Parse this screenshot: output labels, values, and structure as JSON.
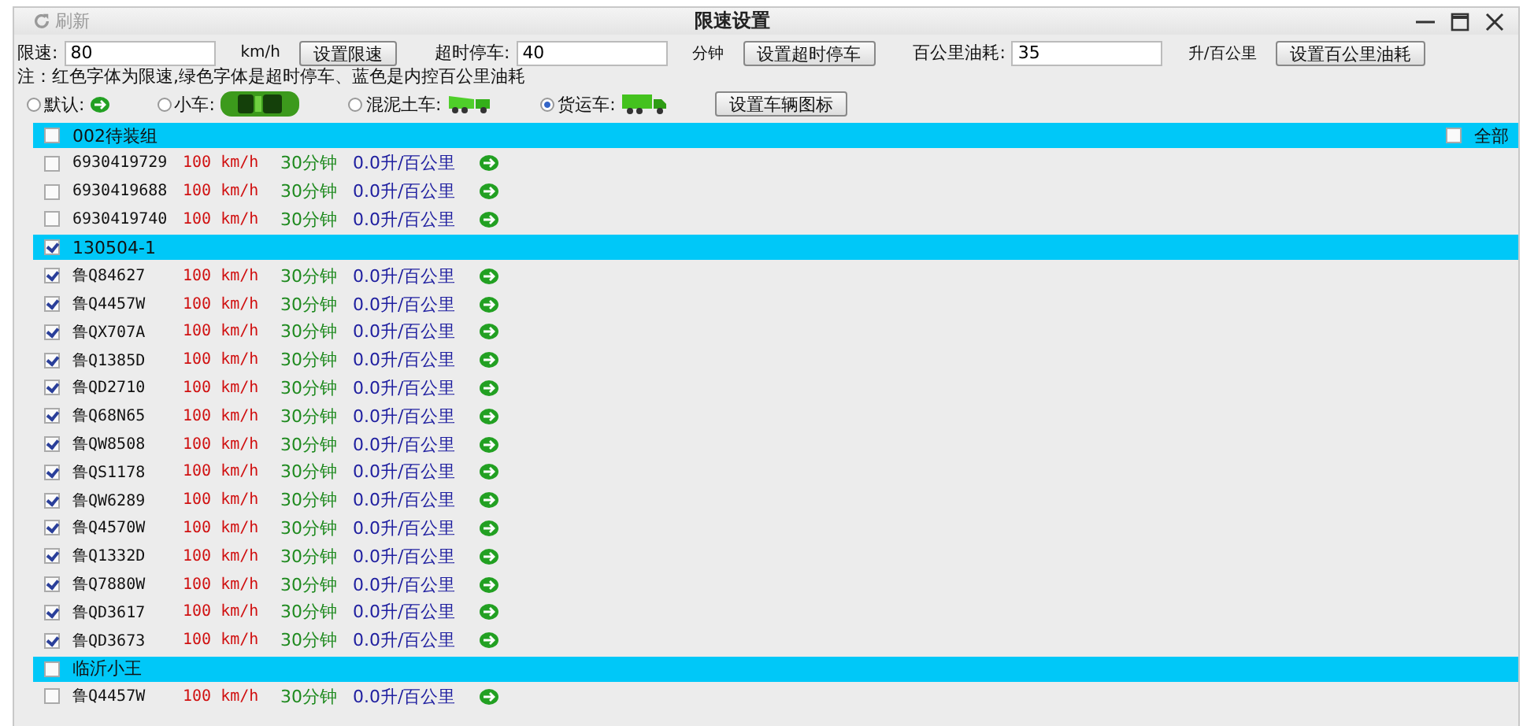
{
  "window": {
    "refresh": "刷新",
    "title": "限速设置"
  },
  "settings": [
    {
      "label": "限速:",
      "value": "80",
      "unit": "km/h",
      "button": "设置限速"
    },
    {
      "label": "超时停车:",
      "value": "40",
      "unit": "分钟",
      "button": "设置超时停车"
    },
    {
      "label": "百公里油耗:",
      "value": "35",
      "unit": "升/百公里",
      "button": "设置百公里油耗"
    }
  ],
  "note": "注：红色字体为限速,绿色字体是超时停车、蓝色是内控百公里油耗",
  "icon_options": [
    {
      "label": "默认:",
      "kind": "default",
      "selected": false
    },
    {
      "label": "小车:",
      "kind": "car",
      "selected": false
    },
    {
      "label": "混泥土车:",
      "kind": "mixer",
      "selected": false
    },
    {
      "label": "货运车:",
      "kind": "truck",
      "selected": true
    }
  ],
  "icon_button": "设置车辆图标",
  "select_all": {
    "label": "全部",
    "checked": false
  },
  "groups": [
    {
      "name": "002待装组",
      "checked": false,
      "vehicles": [
        {
          "plate": "6930419729",
          "speed": "100 km/h",
          "stop": "30分钟",
          "fuel": "0.0升/百公里",
          "checked": false
        },
        {
          "plate": "6930419688",
          "speed": "100 km/h",
          "stop": "30分钟",
          "fuel": "0.0升/百公里",
          "checked": false
        },
        {
          "plate": "6930419740",
          "speed": "100 km/h",
          "stop": "30分钟",
          "fuel": "0.0升/百公里",
          "checked": false
        }
      ]
    },
    {
      "name": "130504-1",
      "checked": true,
      "vehicles": [
        {
          "plate": "鲁Q84627",
          "speed": "100 km/h",
          "stop": "30分钟",
          "fuel": "0.0升/百公里",
          "checked": true
        },
        {
          "plate": "鲁Q4457W",
          "speed": "100 km/h",
          "stop": "30分钟",
          "fuel": "0.0升/百公里",
          "checked": true
        },
        {
          "plate": "鲁QX707A",
          "speed": "100 km/h",
          "stop": "30分钟",
          "fuel": "0.0升/百公里",
          "checked": true
        },
        {
          "plate": "鲁Q1385D",
          "speed": "100 km/h",
          "stop": "30分钟",
          "fuel": "0.0升/百公里",
          "checked": true
        },
        {
          "plate": "鲁QD2710",
          "speed": "100 km/h",
          "stop": "30分钟",
          "fuel": "0.0升/百公里",
          "checked": true
        },
        {
          "plate": "鲁Q68N65",
          "speed": "100 km/h",
          "stop": "30分钟",
          "fuel": "0.0升/百公里",
          "checked": true
        },
        {
          "plate": "鲁QW8508",
          "speed": "100 km/h",
          "stop": "30分钟",
          "fuel": "0.0升/百公里",
          "checked": true
        },
        {
          "plate": "鲁QS1178",
          "speed": "100 km/h",
          "stop": "30分钟",
          "fuel": "0.0升/百公里",
          "checked": true
        },
        {
          "plate": "鲁QW6289",
          "speed": "100 km/h",
          "stop": "30分钟",
          "fuel": "0.0升/百公里",
          "checked": true
        },
        {
          "plate": "鲁Q4570W",
          "speed": "100 km/h",
          "stop": "30分钟",
          "fuel": "0.0升/百公里",
          "checked": true
        },
        {
          "plate": "鲁Q1332D",
          "speed": "100 km/h",
          "stop": "30分钟",
          "fuel": "0.0升/百公里",
          "checked": true
        },
        {
          "plate": "鲁Q7880W",
          "speed": "100 km/h",
          "stop": "30分钟",
          "fuel": "0.0升/百公里",
          "checked": true
        },
        {
          "plate": "鲁QD3617",
          "speed": "100 km/h",
          "stop": "30分钟",
          "fuel": "0.0升/百公里",
          "checked": true
        },
        {
          "plate": "鲁QD3673",
          "speed": "100 km/h",
          "stop": "30分钟",
          "fuel": "0.0升/百公里",
          "checked": true
        }
      ]
    },
    {
      "name": "临沂小王",
      "checked": false,
      "vehicles": [
        {
          "plate": "鲁Q4457W",
          "speed": "100 km/h",
          "stop": "30分钟",
          "fuel": "0.0升/百公里",
          "checked": false
        }
      ]
    }
  ]
}
